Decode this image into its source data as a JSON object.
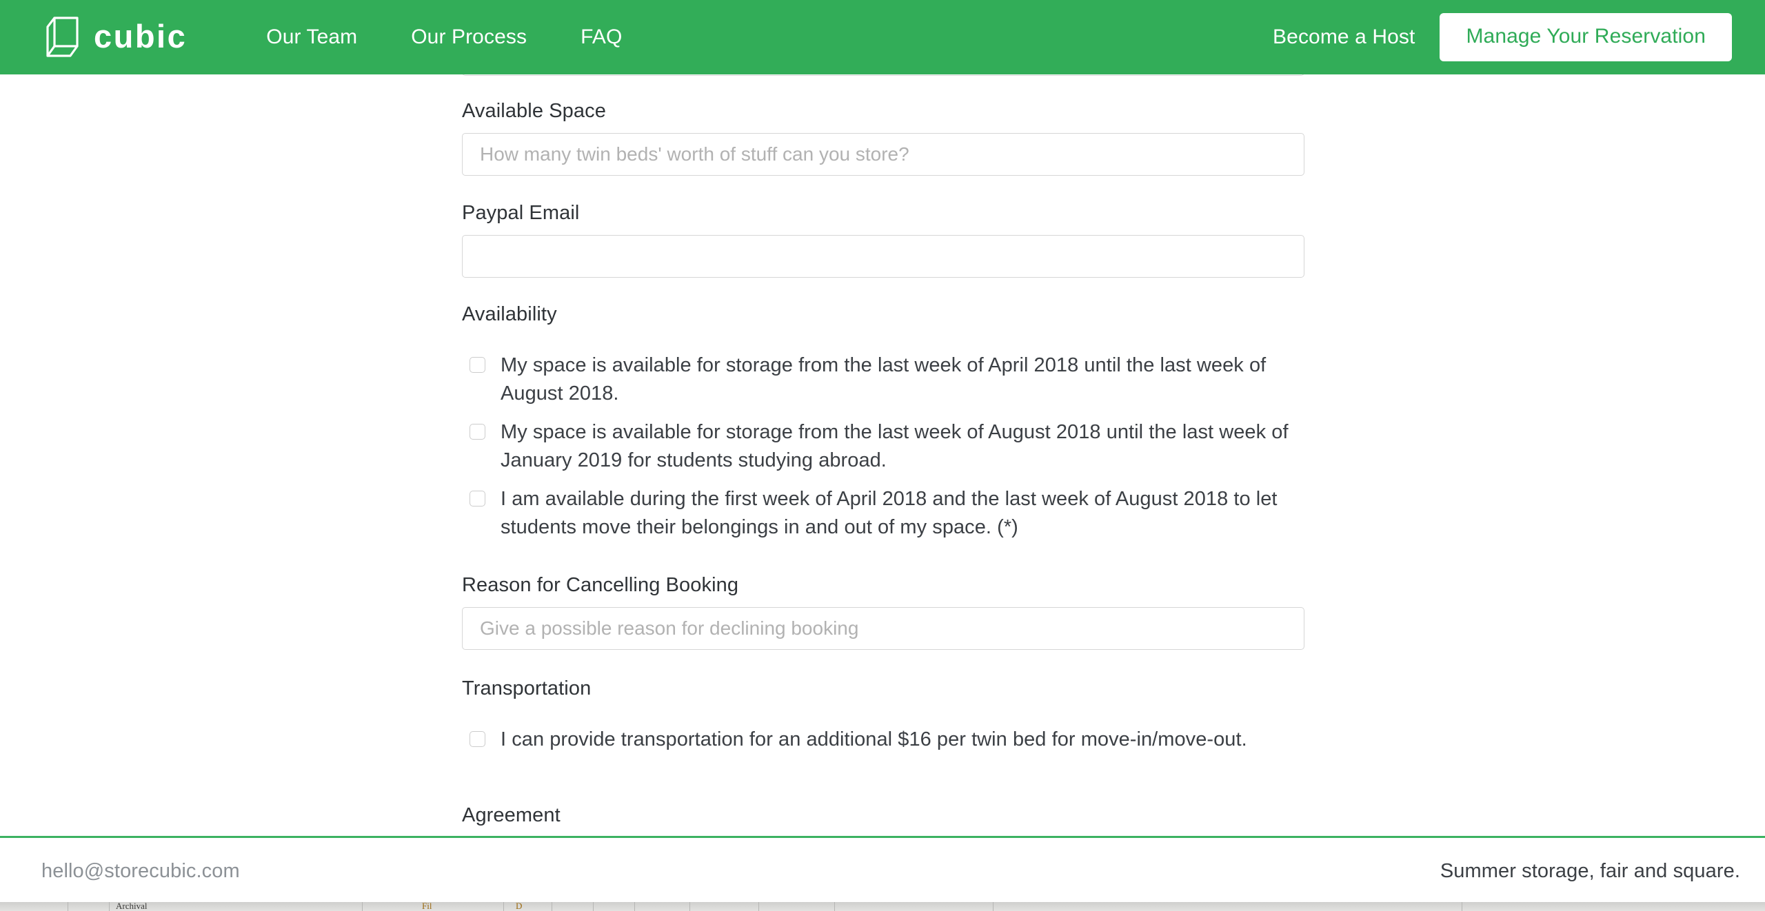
{
  "navbar": {
    "brand": {
      "logo_icon": "cube-icon",
      "word": "cubic"
    },
    "links": [
      {
        "label": "Our Team"
      },
      {
        "label": "Our Process"
      },
      {
        "label": "FAQ"
      }
    ],
    "become_host_label": "Become a Host",
    "manage_reservation_label": "Manage Your Reservation",
    "background_color": "#32AD58",
    "button_text_color": "#2FAB57"
  },
  "form": {
    "available_space": {
      "label": "Available Space",
      "placeholder": "How many twin beds' worth of stuff can you store?",
      "value": ""
    },
    "paypal_email": {
      "label": "Paypal Email",
      "placeholder": "",
      "value": ""
    },
    "availability": {
      "label": "Availability",
      "options": [
        {
          "text": "My space is available for storage from the last week of April 2018 until the last week of August 2018.",
          "checked": false
        },
        {
          "text": "My space is available for storage from the last week of August 2018 until the last week of January 2019 for students studying abroad.",
          "checked": false
        },
        {
          "text": "I am available during the first week of April 2018 and the last week of August 2018 to let students move their belongings in and out of my space. (*)",
          "checked": false
        }
      ]
    },
    "cancel_reason": {
      "label": "Reason for Cancelling Booking",
      "placeholder": "Give a possible reason for declining booking",
      "value": ""
    },
    "transportation": {
      "label": "Transportation",
      "options": [
        {
          "text": "I can provide transportation for an additional $16 per twin bed for move-in/move-out.",
          "checked": false
        }
      ]
    },
    "agreement": {
      "label": "Agreement"
    }
  },
  "footer": {
    "email": "hello@storecubic.com",
    "tagline": "Summer storage, fair and square.",
    "accent_color": "#3BB261"
  },
  "background_peek": {
    "label_left": "Archival",
    "label_mid": "Fil",
    "label_mid2": "D"
  }
}
